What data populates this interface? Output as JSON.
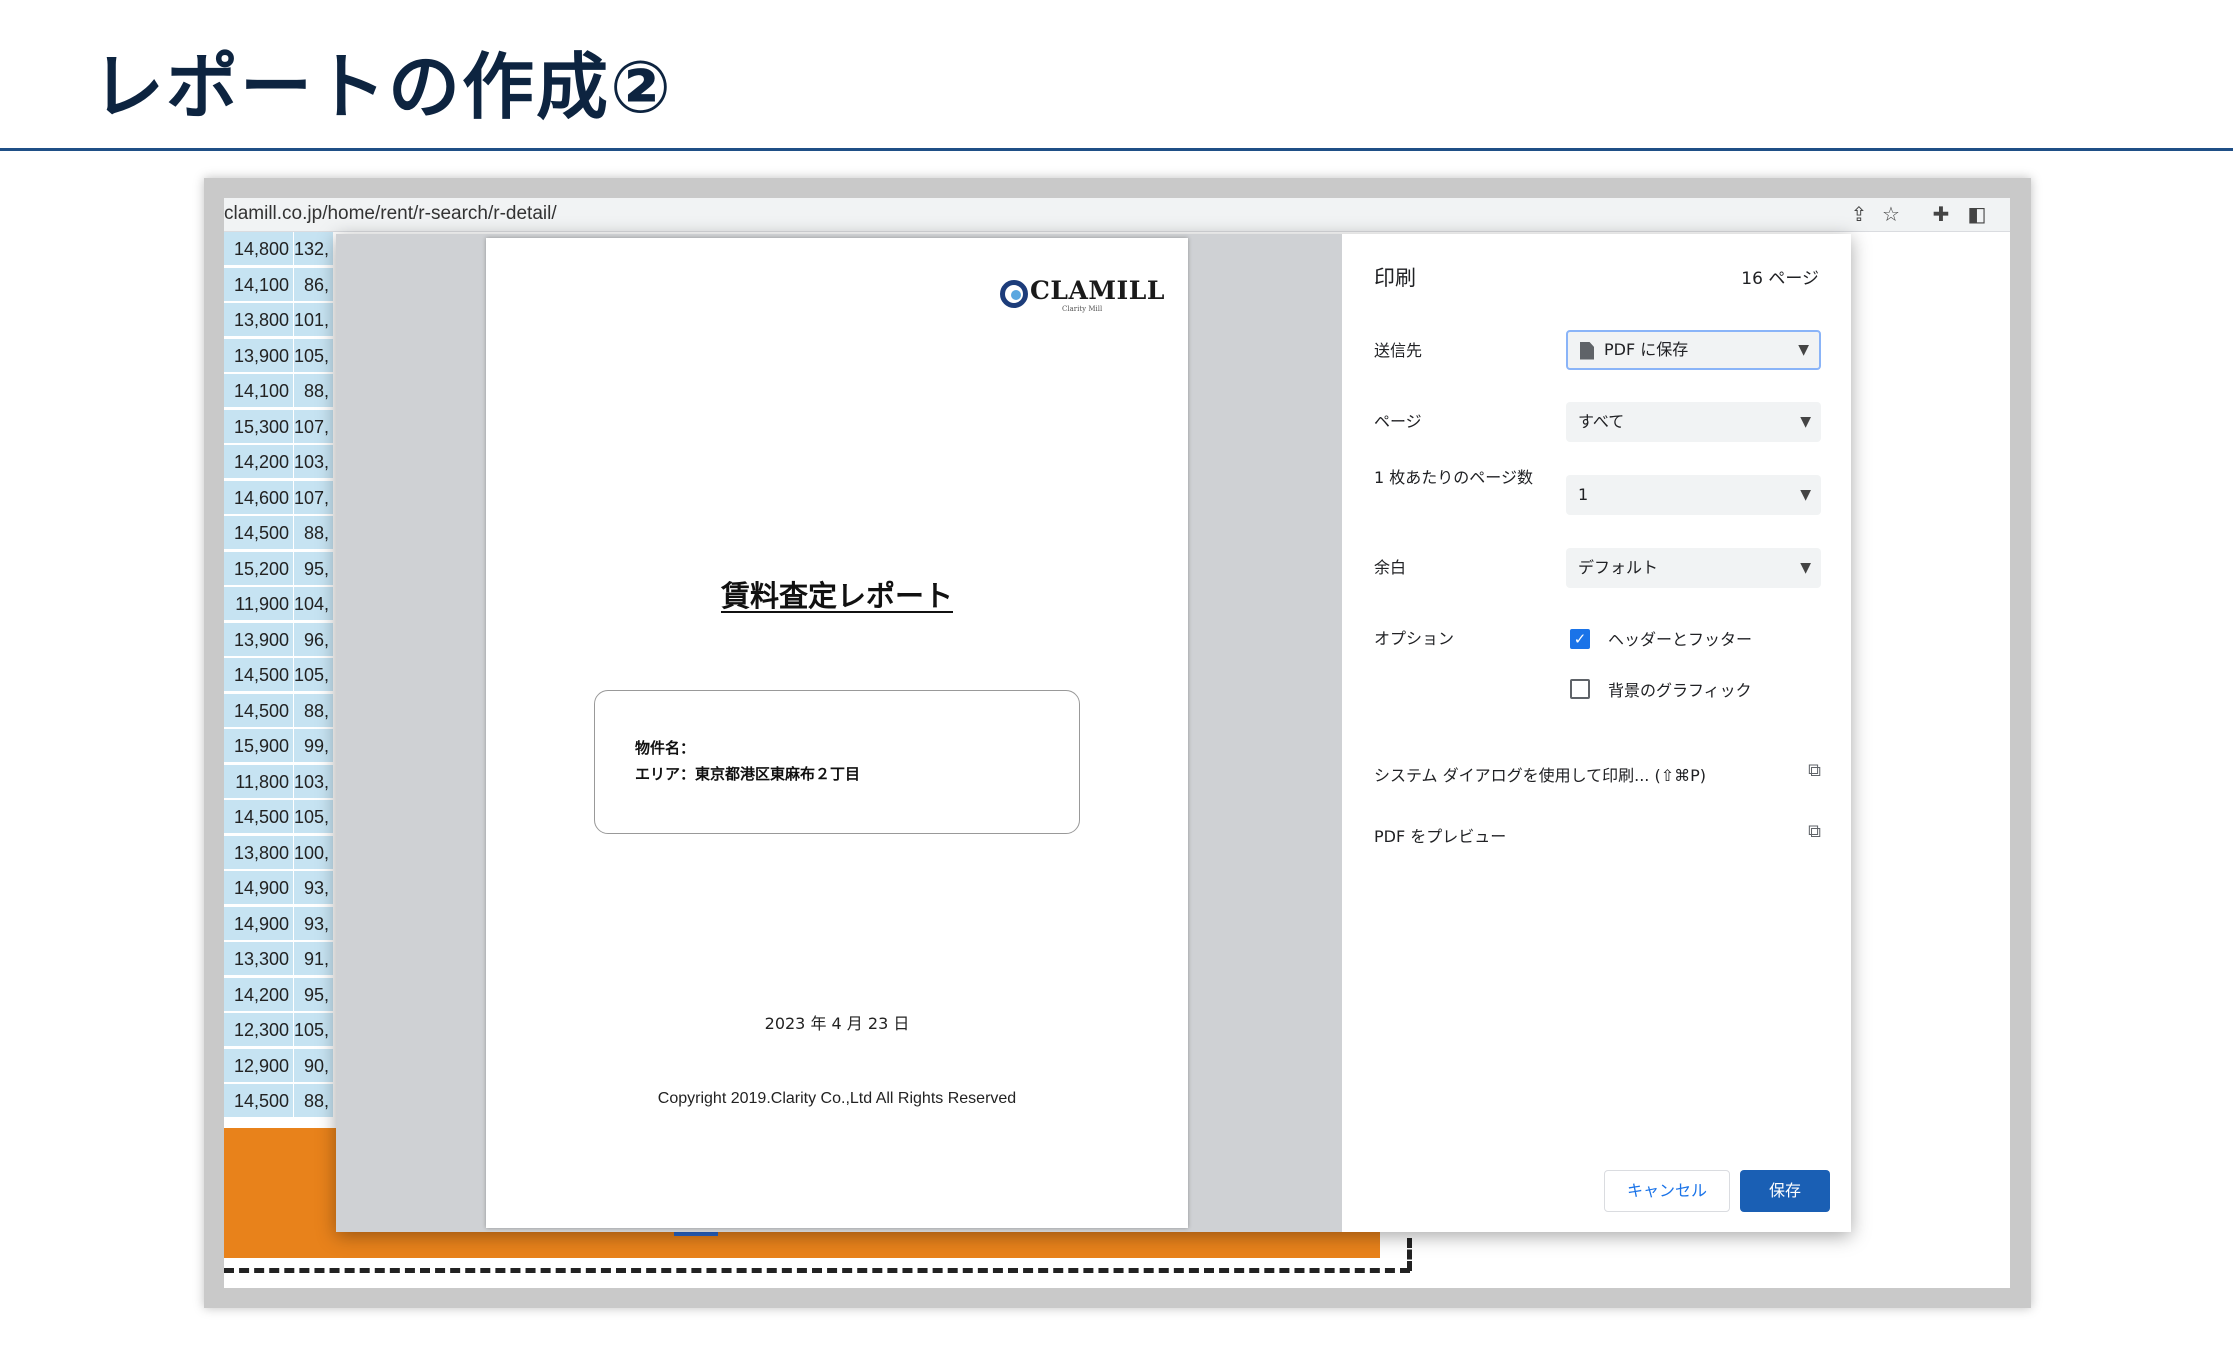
{
  "slide": {
    "title": "レポートの作成②"
  },
  "browser": {
    "url": "clamill.co.jp/home/rent/r-search/r-detail/",
    "icons": [
      "share-icon",
      "star-icon",
      "extension-icon",
      "sidepanel-icon"
    ]
  },
  "table_rows": [
    [
      "14,800",
      "132,"
    ],
    [
      "14,100",
      "86,"
    ],
    [
      "13,800",
      "101,"
    ],
    [
      "13,900",
      "105,"
    ],
    [
      "14,100",
      "88,"
    ],
    [
      "15,300",
      "107,"
    ],
    [
      "14,200",
      "103,"
    ],
    [
      "14,600",
      "107,"
    ],
    [
      "14,500",
      "88,"
    ],
    [
      "15,200",
      "95,"
    ],
    [
      "11,900",
      "104,"
    ],
    [
      "13,900",
      "96,"
    ],
    [
      "14,500",
      "105,"
    ],
    [
      "14,500",
      "88,"
    ],
    [
      "15,900",
      "99,"
    ],
    [
      "11,800",
      "103,"
    ],
    [
      "14,500",
      "105,"
    ],
    [
      "13,800",
      "100,"
    ],
    [
      "14,900",
      "93,"
    ],
    [
      "14,900",
      "93,"
    ],
    [
      "13,300",
      "91,"
    ],
    [
      "14,200",
      "95,"
    ],
    [
      "12,300",
      "105,"
    ],
    [
      "12,900",
      "90,"
    ],
    [
      "14,500",
      "88,"
    ]
  ],
  "preview": {
    "logo_text": "CLAMILL",
    "logo_sub": "Clarity Mill",
    "report_title": "賃料査定レポート",
    "property_label": "物件名：",
    "area_line": "エリア：東京都港区東麻布２丁目",
    "date": "2023 年 4 月 23 日",
    "copyright": "Copyright 2019.Clarity Co.,Ltd All Rights Reserved"
  },
  "print": {
    "title": "印刷",
    "page_count": "16 ページ",
    "destination_label": "送信先",
    "destination_value": "PDF に保存",
    "pages_label": "ページ",
    "pages_value": "すべて",
    "per_sheet_label": "1 枚あたりのページ数",
    "per_sheet_value": "1",
    "margin_label": "余白",
    "margin_value": "デフォルト",
    "options_label": "オプション",
    "option_header_footer": "ヘッダーとフッター",
    "option_header_footer_checked": true,
    "option_background": "背景のグラフィック",
    "option_background_checked": false,
    "system_dialog": "システム ダイアログを使用して印刷... (⇧⌘P)",
    "pdf_preview": "PDF をプレビュー",
    "cancel": "キャンセル",
    "save": "保存"
  }
}
